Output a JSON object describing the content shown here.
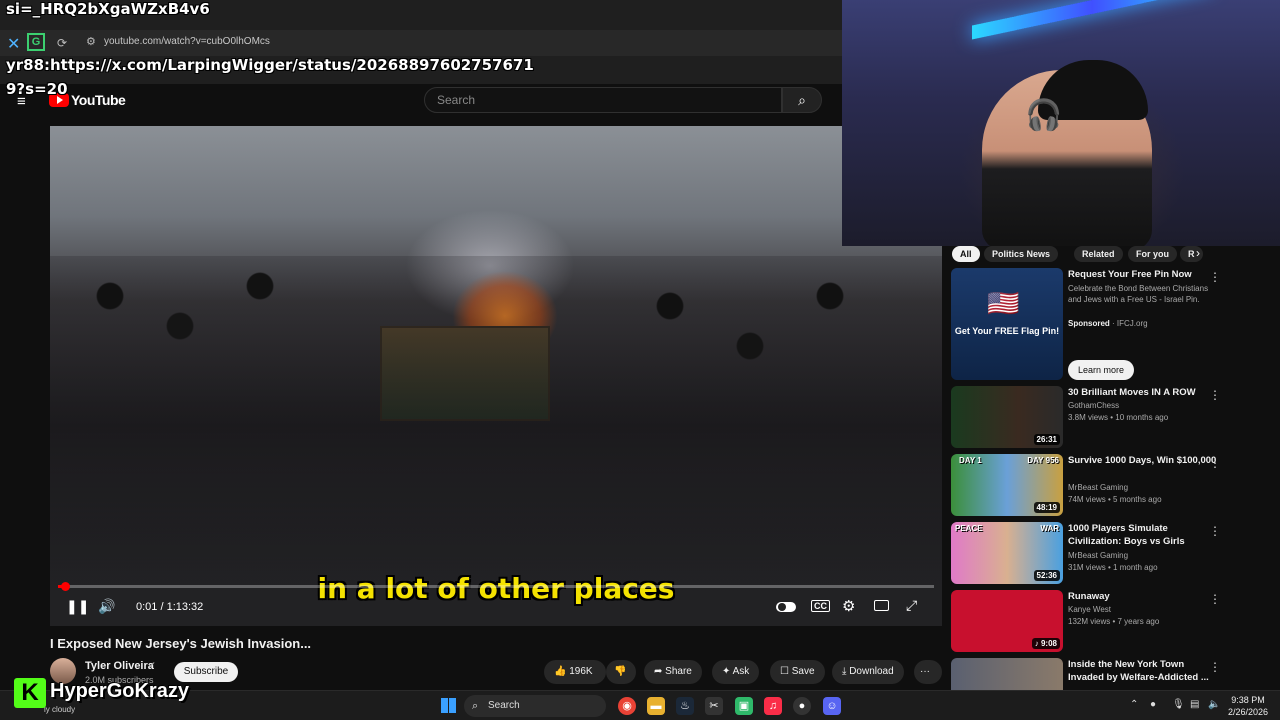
{
  "overlay": {
    "line1": "si=_HRQ2bXgaWZxB4v6",
    "line2_prefix": "yr88:",
    "line2_url": "https://x.com/LarpingWigger/status/20268897602757671",
    "line3": "9?s=20"
  },
  "browser": {
    "url": "youtube.com/watch?v=cubO0lhOMcs"
  },
  "masthead": {
    "logo_text": "YouTube",
    "search_placeholder": "Search"
  },
  "video": {
    "caption": "in a lot of other places",
    "time": "0:01 / 1:13:32",
    "progress_fraction": 0.001,
    "title": "I Exposed New Jersey's Jewish Invasion..."
  },
  "channel": {
    "name": "Tyler Oliveira",
    "subscribers": "2.0M subscribers",
    "subscribe_label": "Subscribe"
  },
  "actions": {
    "likes": "196K",
    "share": "Share",
    "ask": "Ask",
    "save": "Save",
    "download": "Download",
    "more": "···"
  },
  "sidebar": {
    "chips": [
      "All",
      "Politics News",
      "Related",
      "For you",
      "R"
    ],
    "ad": {
      "title": "Request Your Free Pin Now",
      "description": "Celebrate the Bond Between Christians and Jews with a Free US - Israel Pin.",
      "sponsored": "Sponsored",
      "advertiser": "IFCJ.org",
      "thumb_text": "Get Your FREE Flag Pin!",
      "cta": "Learn more"
    },
    "items": [
      {
        "title": "30 Brilliant Moves IN A ROW",
        "channel": "GothamChess",
        "meta": "3.8M views • 10 months ago",
        "duration": "26:31"
      },
      {
        "title": "Survive 1000 Days, Win $100,000",
        "channel": "MrBeast Gaming",
        "meta": "74M views • 5 months ago",
        "duration": "48:19",
        "thumb_left": "DAY 1",
        "thumb_right": "DAY 956"
      },
      {
        "title": "1000 Players Simulate Civilization: Boys vs Girls",
        "channel": "MrBeast Gaming",
        "meta": "31M views • 1 month ago",
        "duration": "52:36",
        "thumb_left": "PEACE",
        "thumb_right": "WAR"
      },
      {
        "title": "Runaway",
        "channel": "Kanye West",
        "meta": "132M views • 7 years ago",
        "duration": "9:08"
      },
      {
        "title": "Inside the New York Town Invaded by Welfare-Addicted ...",
        "channel": "",
        "meta": "",
        "duration": ""
      }
    ]
  },
  "taskbar": {
    "search": "Search",
    "weather": "ly cloudy",
    "time": "9:38 PM",
    "date": "2/26/2026"
  },
  "watermark": {
    "logo": "K",
    "name": "HyperGoKrazy"
  },
  "colors": {
    "accent": "#ff0000",
    "caption": "#f4e200",
    "kick": "#53fc18"
  }
}
